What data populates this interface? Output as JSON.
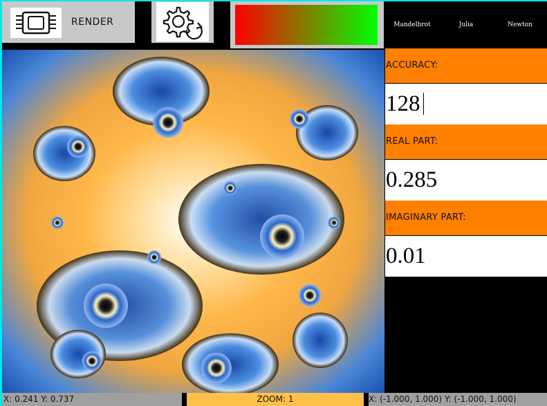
{
  "toolbar": {
    "render_label": "RENDER",
    "render_icon": "cpu-chip-icon",
    "settings_icon": "gear-refresh-icon",
    "gradient_colors": [
      "#ff0000",
      "#00ff00"
    ]
  },
  "fractal_tabs": [
    "Mandelbrot",
    "Julia",
    "Newton"
  ],
  "parameters": {
    "accuracy_label": "ACCURACY:",
    "accuracy_value": "128",
    "real_label": "REAL PART:",
    "real_value": "0.285",
    "imaginary_label": "IMAGINARY PART:",
    "imaginary_value": "0.01"
  },
  "status": {
    "cursor": "X: 0.241 Y: 0.737",
    "zoom": "ZOOM: 1",
    "range": "X: (-1.000, 1.000) Y: (-1.000, 1.000)"
  },
  "colors": {
    "accent_orange": "#ff7f00",
    "frame_cyan": "#00e8e8",
    "button_gray": "#c8c8c8",
    "status_gray": "#a0a0a0",
    "zoom_orange": "#ffc04a"
  }
}
